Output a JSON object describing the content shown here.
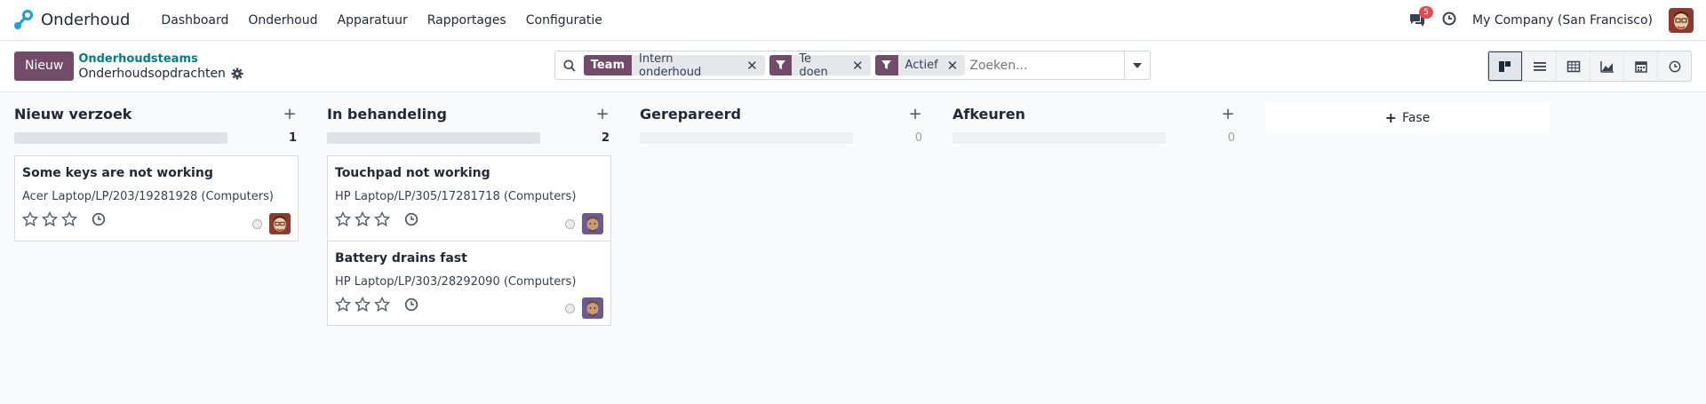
{
  "navbar": {
    "app_name": "Onderhoud",
    "menu": [
      "Dashboard",
      "Onderhoud",
      "Apparatuur",
      "Rapportages",
      "Configuratie"
    ],
    "chat_badge": "5",
    "company": "My Company (San Francisco)"
  },
  "control": {
    "new_label": "Nieuw",
    "breadcrumb_parent": "Onderhoudsteams",
    "breadcrumb_current": "Onderhoudsopdrachten"
  },
  "search": {
    "facets": [
      {
        "label": "Team",
        "value": "Intern onderhoud",
        "type": "group"
      },
      {
        "label": "",
        "value": "Te doen",
        "type": "filter"
      },
      {
        "label": "",
        "value": "Actief",
        "type": "filter"
      }
    ],
    "placeholder": "Zoeken..."
  },
  "views": [
    "kanban",
    "list",
    "pivot",
    "graph",
    "calendar",
    "activity"
  ],
  "columns": [
    {
      "title": "Nieuw verzoek",
      "count": "1",
      "progress": 1,
      "cards": [
        {
          "title": "Some keys are not working",
          "equipment": "Acer Laptop/LP/203/19281928 (Computers)",
          "avatar": "marc"
        }
      ]
    },
    {
      "title": "In behandeling",
      "count": "2",
      "progress": 1,
      "cards": [
        {
          "title": "Touchpad not working",
          "equipment": "HP Laptop/LP/305/17281718 (Computers)",
          "avatar": "mitchell"
        },
        {
          "title": "Battery drains fast",
          "equipment": "HP Laptop/LP/303/28292090 (Computers)",
          "avatar": "mitchell"
        }
      ]
    },
    {
      "title": "Gerepareerd",
      "count": "0",
      "progress": 0,
      "cards": []
    },
    {
      "title": "Afkeuren",
      "count": "0",
      "progress": 0,
      "cards": []
    }
  ],
  "add_stage_label": "Fase",
  "colors": {
    "brand": "#714b67",
    "link": "#017e84",
    "badge": "#e04e55"
  }
}
